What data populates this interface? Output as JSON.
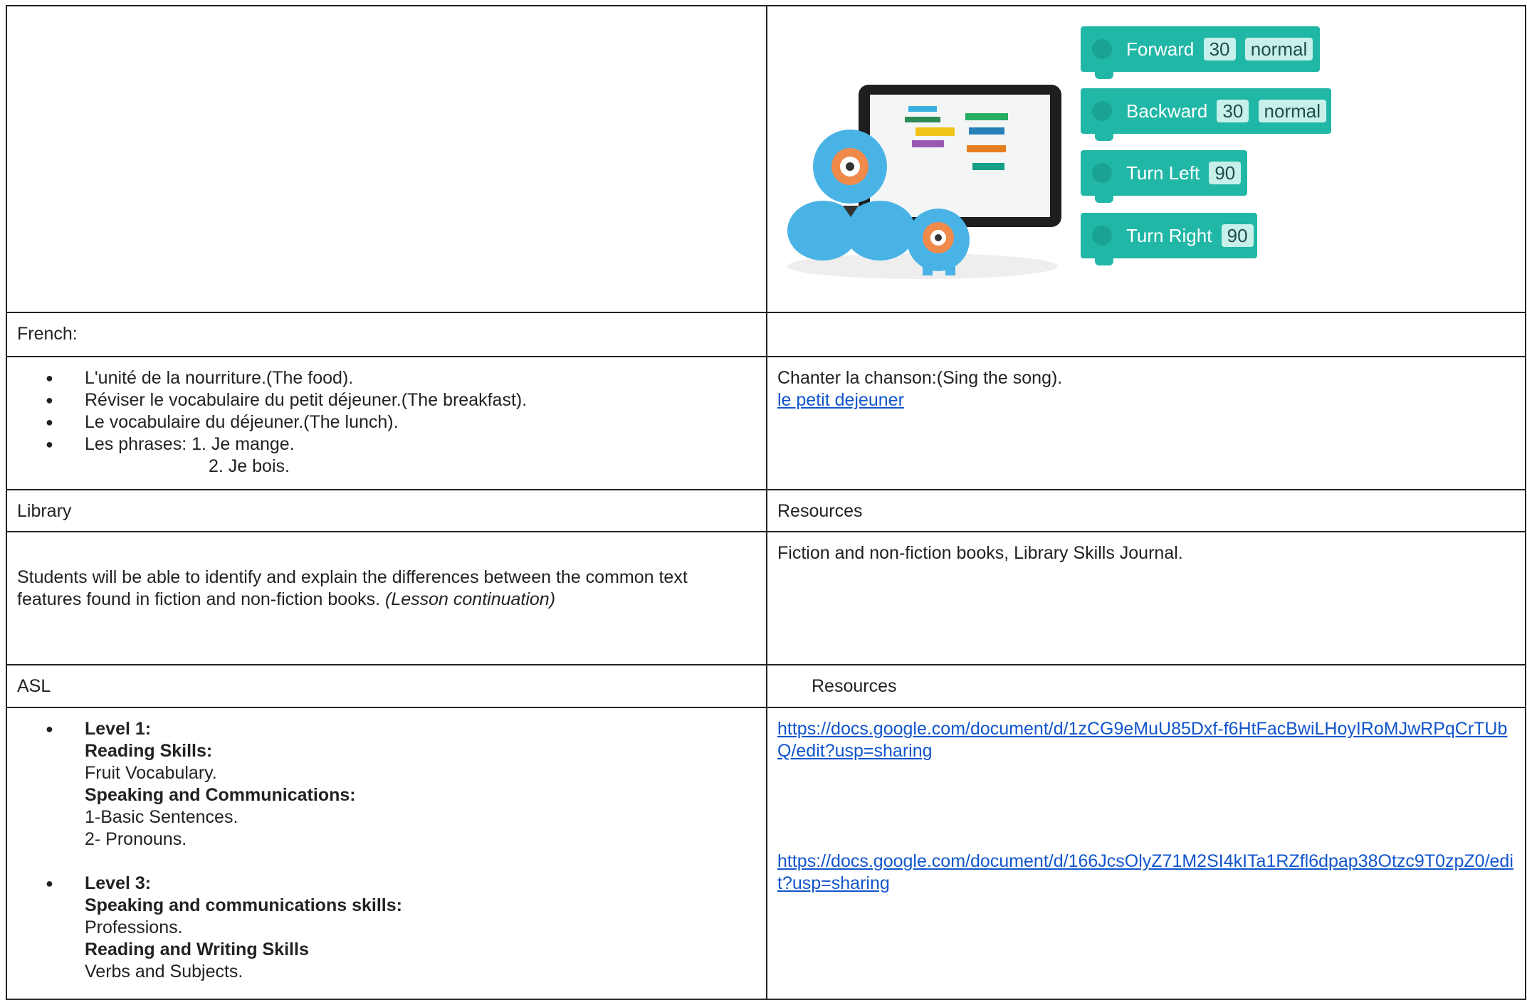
{
  "robot_blocks": [
    {
      "label": "Forward",
      "values": [
        "30",
        "normal"
      ]
    },
    {
      "label": "Backward",
      "values": [
        "30",
        "normal"
      ]
    },
    {
      "label": "Turn Left",
      "values": [
        "90"
      ]
    },
    {
      "label": "Turn Right",
      "values": [
        "90"
      ]
    }
  ],
  "french": {
    "header": "French:",
    "items": [
      "L'unité de la nourriture.(The food).",
      "Réviser le vocabulaire du petit déjeuner.(The breakfast).",
      "Le vocabulaire du déjeuner.(The lunch).",
      "Les phrases: 1. Je mange."
    ],
    "continuation": "2. Je bois.",
    "right_text": "Chanter la chanson:(Sing the song).",
    "right_link": "le petit dejeuner"
  },
  "library": {
    "header": "Library",
    "resources_header": "Resources",
    "body": "Students will be able to identify and explain the differences between the common text features found in fiction and non-fiction books.",
    "body_italic": "(Lesson continuation)",
    "resources": "Fiction and non-fiction books, Library Skills Journal."
  },
  "asl": {
    "header": "ASL",
    "resources_header": "Resources",
    "level1": {
      "title": "Level 1:",
      "reading_title": "Reading Skills:",
      "reading_item": "Fruit Vocabulary.",
      "speaking_title": "Speaking and Communications:",
      "speaking_items": [
        "1-Basic Sentences.",
        "2- Pronouns."
      ]
    },
    "level3": {
      "title": "Level 3:",
      "speaking_title": "Speaking and communications skills:",
      "speaking_item": "Professions.",
      "reading_title": "Reading and Writing Skills",
      "reading_item": "Verbs and Subjects."
    },
    "links": [
      "https://docs.google.com/document/d/1zCG9eMuU85Dxf-f6HtFacBwiLHoyIRoMJwRPqCrTUbQ/edit?usp=sharing",
      "https://docs.google.com/document/d/166JcsOlyZ71M2SI4kITa1RZfl6dpap38Otzc9T0zpZ0/edit?usp=sharing"
    ]
  }
}
